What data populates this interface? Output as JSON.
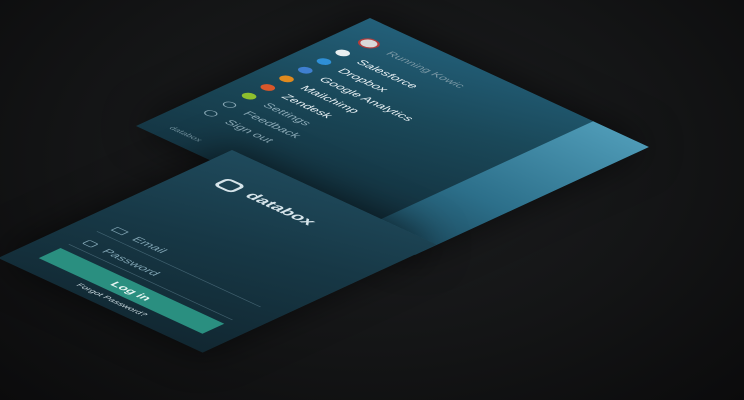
{
  "login": {
    "brand": "databox",
    "email_placeholder": "Email",
    "password_placeholder": "Password",
    "login_label": "Log in",
    "forgot_label": "Forgot Password?"
  },
  "menu": {
    "account": "Running Kowic",
    "items": [
      {
        "label": "Salesforce",
        "color": "#e9eef0"
      },
      {
        "label": "Dropbox",
        "color": "#2f8fd6"
      },
      {
        "label": "Google Analytics",
        "color": "#3f7fd0"
      },
      {
        "label": "Mailchimp",
        "color": "#e08a1e"
      },
      {
        "label": "Zendesk",
        "color": "#d9572a"
      },
      {
        "label": "Settings",
        "color": "#8dbf2e"
      }
    ],
    "secondary": [
      {
        "label": "Feedback"
      },
      {
        "label": "Sign out"
      }
    ],
    "footer": "databox"
  },
  "colors": {
    "accent": "#2a8f80",
    "panel": "#173846"
  }
}
